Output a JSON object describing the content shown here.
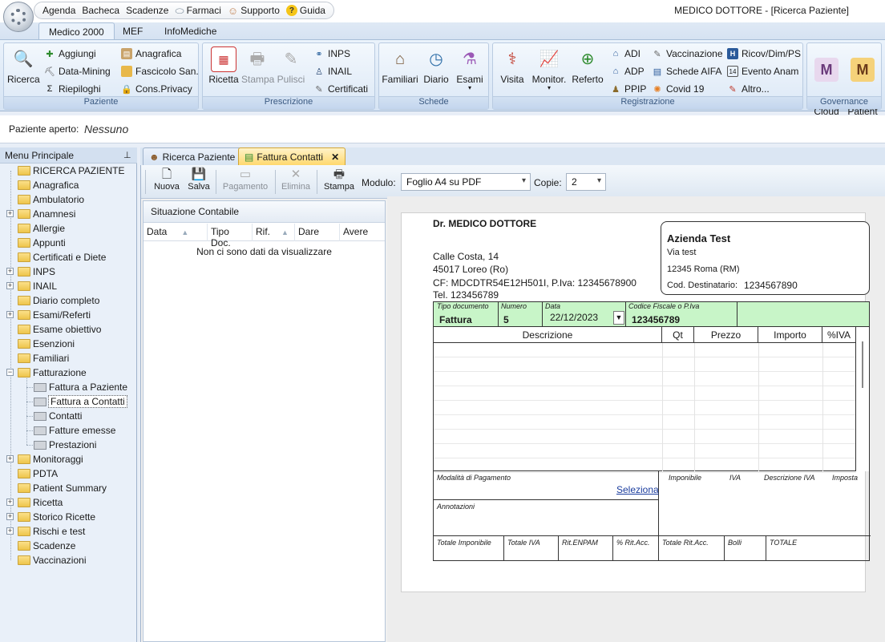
{
  "quick_menu": {
    "items": [
      {
        "label": "Agenda",
        "icon": "none"
      },
      {
        "label": "Bacheca",
        "icon": "none"
      },
      {
        "label": "Scadenze",
        "icon": "none"
      },
      {
        "label": "Farmaci",
        "icon": "pill-icon"
      },
      {
        "label": "Supporto",
        "icon": "support-icon"
      },
      {
        "label": "Guida",
        "icon": "help-icon"
      }
    ]
  },
  "window": {
    "title": "MEDICO DOTTORE - [Ricerca Paziente]"
  },
  "ribbon": {
    "tabs": [
      "Medico 2000",
      "MEF",
      "InfoMediche"
    ],
    "active_tab": "Medico 2000",
    "groups": {
      "paziente": {
        "label": "Paziente",
        "ricerca": "Ricerca",
        "aggiungi": "Aggiungi",
        "data_mining": "Data-Mining",
        "riepiloghi": "Riepiloghi",
        "anagrafica": "Anagrafica",
        "fascicolo": "Fascicolo San.",
        "cons_privacy": "Cons.Privacy"
      },
      "prescrizione": {
        "label": "Prescrizione",
        "ricetta": "Ricetta",
        "stampa": "Stampa",
        "pulisci": "Pulisci",
        "inps": "INPS",
        "inail": "INAIL",
        "certificati": "Certificati"
      },
      "schede": {
        "label": "Schede",
        "familiari": "Familiari",
        "diario": "Diario",
        "esami": "Esami"
      },
      "registrazione": {
        "label": "Registrazione",
        "visita": "Visita",
        "monitor": "Monitor.",
        "referto": "Referto",
        "adi": "ADI",
        "adp": "ADP",
        "ppip": "PPIP",
        "vaccinazione": "Vaccinazione",
        "schede_aifa": "Schede AIFA",
        "covid": "Covid 19",
        "ricov": "Ricov/Dim/PS",
        "evento": "Evento Anam",
        "altro": "Altro..."
      },
      "governance": {
        "label": "Governance",
        "gpg_cloud": "GPG\nCloud",
        "gpg_patient": "GPG\nPatient"
      }
    }
  },
  "patient_bar": {
    "label": "Paziente aperto:",
    "value": "Nessuno"
  },
  "left_menu": {
    "title": "Menu Principale",
    "items": [
      {
        "label": "RICERCA PAZIENTE",
        "expandable": false,
        "level": 0
      },
      {
        "label": "Anagrafica",
        "expandable": false,
        "level": 0
      },
      {
        "label": "Ambulatorio",
        "expandable": false,
        "level": 0
      },
      {
        "label": "Anamnesi",
        "expandable": true,
        "level": 0
      },
      {
        "label": "Allergie",
        "expandable": false,
        "level": 0
      },
      {
        "label": "Appunti",
        "expandable": false,
        "level": 0
      },
      {
        "label": "Certificati e Diete",
        "expandable": false,
        "level": 0
      },
      {
        "label": "INPS",
        "expandable": true,
        "level": 0
      },
      {
        "label": "INAIL",
        "expandable": true,
        "level": 0
      },
      {
        "label": "Diario completo",
        "expandable": false,
        "level": 0
      },
      {
        "label": "Esami/Referti",
        "expandable": true,
        "level": 0
      },
      {
        "label": "Esame obiettivo",
        "expandable": false,
        "level": 0
      },
      {
        "label": "Esenzioni",
        "expandable": false,
        "level": 0
      },
      {
        "label": "Familiari",
        "expandable": false,
        "level": 0
      },
      {
        "label": "Fatturazione",
        "expandable": true,
        "expanded": true,
        "level": 0
      },
      {
        "label": "Fattura a Paziente",
        "level": 1
      },
      {
        "label": "Fattura a Contatti",
        "level": 1,
        "selected": true
      },
      {
        "label": "Contatti",
        "level": 1
      },
      {
        "label": "Fatture emesse",
        "level": 1
      },
      {
        "label": "Prestazioni",
        "level": 1
      },
      {
        "label": "Monitoraggi",
        "expandable": true,
        "level": 0
      },
      {
        "label": "PDTA",
        "expandable": false,
        "level": 0
      },
      {
        "label": "Patient Summary",
        "expandable": false,
        "level": 0
      },
      {
        "label": "Ricetta",
        "expandable": true,
        "level": 0
      },
      {
        "label": "Storico Ricette",
        "expandable": true,
        "level": 0
      },
      {
        "label": "Rischi e test",
        "expandable": true,
        "level": 0
      },
      {
        "label": "Scadenze",
        "expandable": false,
        "level": 0
      },
      {
        "label": "Vaccinazioni",
        "expandable": false,
        "level": 0
      }
    ]
  },
  "doc_tabs": [
    {
      "label": "Ricerca Paziente",
      "active": false
    },
    {
      "label": "Fattura Contatti",
      "active": true
    }
  ],
  "toolbar": {
    "nuova": "Nuova",
    "salva": "Salva",
    "pagamento": "Pagamento",
    "elimina": "Elimina",
    "stampa": "Stampa",
    "modulo_label": "Modulo:",
    "modulo_value": "Foglio A4 su PDF",
    "copie_label": "Copie:",
    "copie_value": "2"
  },
  "situazione": {
    "title": "Situazione Contabile",
    "columns": [
      "Data",
      "Tipo Doc.",
      "Rif.",
      "Dare",
      "Avere"
    ],
    "empty_message": "Non ci sono dati da visualizzare"
  },
  "invoice": {
    "doctor_name": "Dr. MEDICO DOTTORE",
    "address": "Calle Costa, 14",
    "city": "45017 Loreo (Ro)",
    "cf": "CF: MDCDTR54E12H501I, P.Iva: 12345678900",
    "tel": "Tel. 123456789",
    "client": {
      "name": "Azienda Test",
      "street": "Via test",
      "city": "12345 Roma (RM)",
      "code_label": "Cod. Destinatario:",
      "code": "1234567890"
    },
    "header": {
      "tipo_label": "Tipo documento",
      "tipo_value": "Fattura",
      "numero_label": "Numero",
      "numero_value": "5",
      "data_label": "Data",
      "data_value": "22/12/2023",
      "cf_label": "Codice Fiscale o P.Iva",
      "cf_value": "123456789"
    },
    "grid_columns": [
      "Descrizione",
      "Qt",
      "Prezzo",
      "Importo",
      "%IVA"
    ],
    "payment_label": "Modalità di Pagamento",
    "seleziona": "Seleziona",
    "annotazioni_label": "Annotazioni",
    "tax_cols": [
      "Imponibile",
      "IVA",
      "Descrizione IVA",
      "Imposta"
    ],
    "totals": [
      "Totale Imponibile",
      "Totale IVA",
      "Rit.ENPAM",
      "% Rit.Acc.",
      "Totale Rit.Acc.",
      "Bolli",
      "TOTALE"
    ]
  }
}
